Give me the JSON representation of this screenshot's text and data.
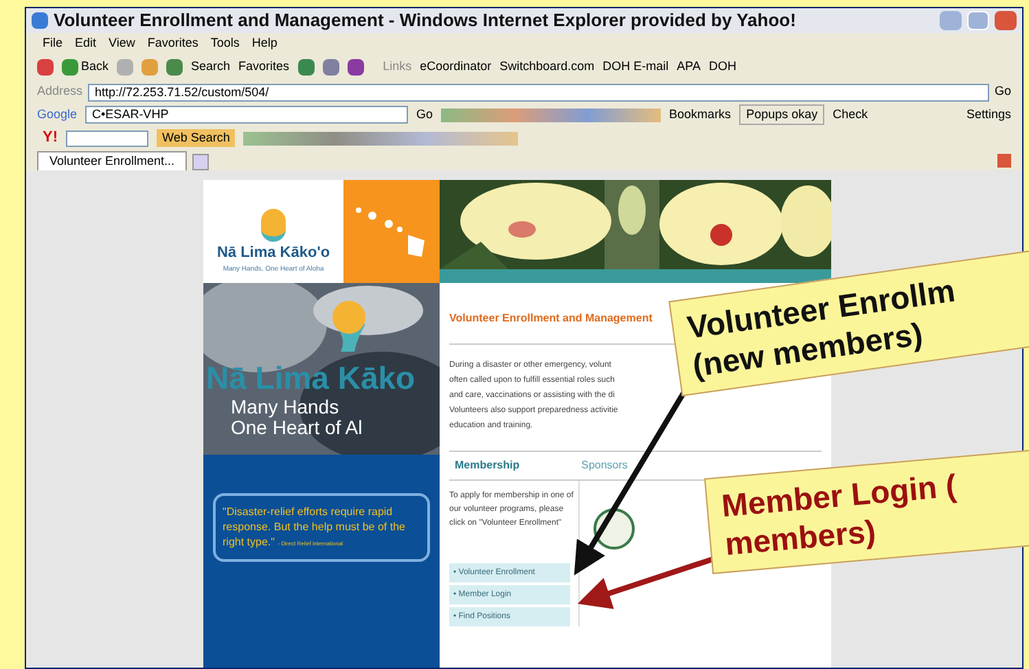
{
  "window": {
    "title": "Volunteer Enrollment and Management - Windows Internet Explorer provided by Yahoo!"
  },
  "menu": [
    "File",
    "Edit",
    "View",
    "Favorites",
    "Tools",
    "Help"
  ],
  "toolbar": {
    "back": "Back",
    "search": "Search",
    "favorites": "Favorites",
    "links_label": "Links",
    "links": [
      "eCoordinator",
      "Switchboard.com",
      "DOH E-mail",
      "APA",
      "DOH"
    ]
  },
  "address": {
    "label": "Address",
    "value": "http://72.253.71.52/custom/504/",
    "go": "Go"
  },
  "google_bar": {
    "logo": "Google",
    "query": "C•ESAR-VHP",
    "go": "Go",
    "bookmarks": "Bookmarks",
    "popups": "Popups okay",
    "check": "Check",
    "settings": "Settings"
  },
  "yahoo_bar": {
    "logo": "Y!",
    "search": "Web Search"
  },
  "tabs": [
    {
      "label": "Volunteer Enrollment...",
      "selected": true
    }
  ],
  "page": {
    "logo": {
      "title": "Nā Lima Kāko'o",
      "tagline": "Many Hands, One Heart of Aloha"
    },
    "banner": {
      "title": "Nā Lima Kāko",
      "subtitle_1": "Many Hands",
      "subtitle_2": "One Heart of Al"
    },
    "quote": {
      "text": "\"Disaster-relief efforts require rapid response. But the help must be of the right type.\"",
      "source": "- Direct Relief International"
    },
    "heading": "Volunteer Enrollment and Management",
    "intro_lines": [
      "During a disaster or other emergency, volunt",
      "often called upon to fulfill essential roles such",
      "and care, vaccinations or assisting with the di",
      "Volunteers also support preparedness activitie",
      "education and training."
    ],
    "section_tabs": [
      {
        "label": "Membership",
        "selected": true
      },
      {
        "label": "Sponsors",
        "selected": false
      }
    ],
    "membership_text": "To apply for membership in one of our volunteer programs, please click on \"Volunteer Enrollment\"",
    "links": [
      "• Volunteer Enrollment",
      "• Member Login",
      "• Find Positions"
    ]
  },
  "callouts": [
    {
      "kind": "enroll",
      "lines": [
        "Volunteer Enrollm",
        "(new members)"
      ]
    },
    {
      "kind": "login",
      "lines": [
        "Member Login (",
        "members)"
      ]
    }
  ]
}
